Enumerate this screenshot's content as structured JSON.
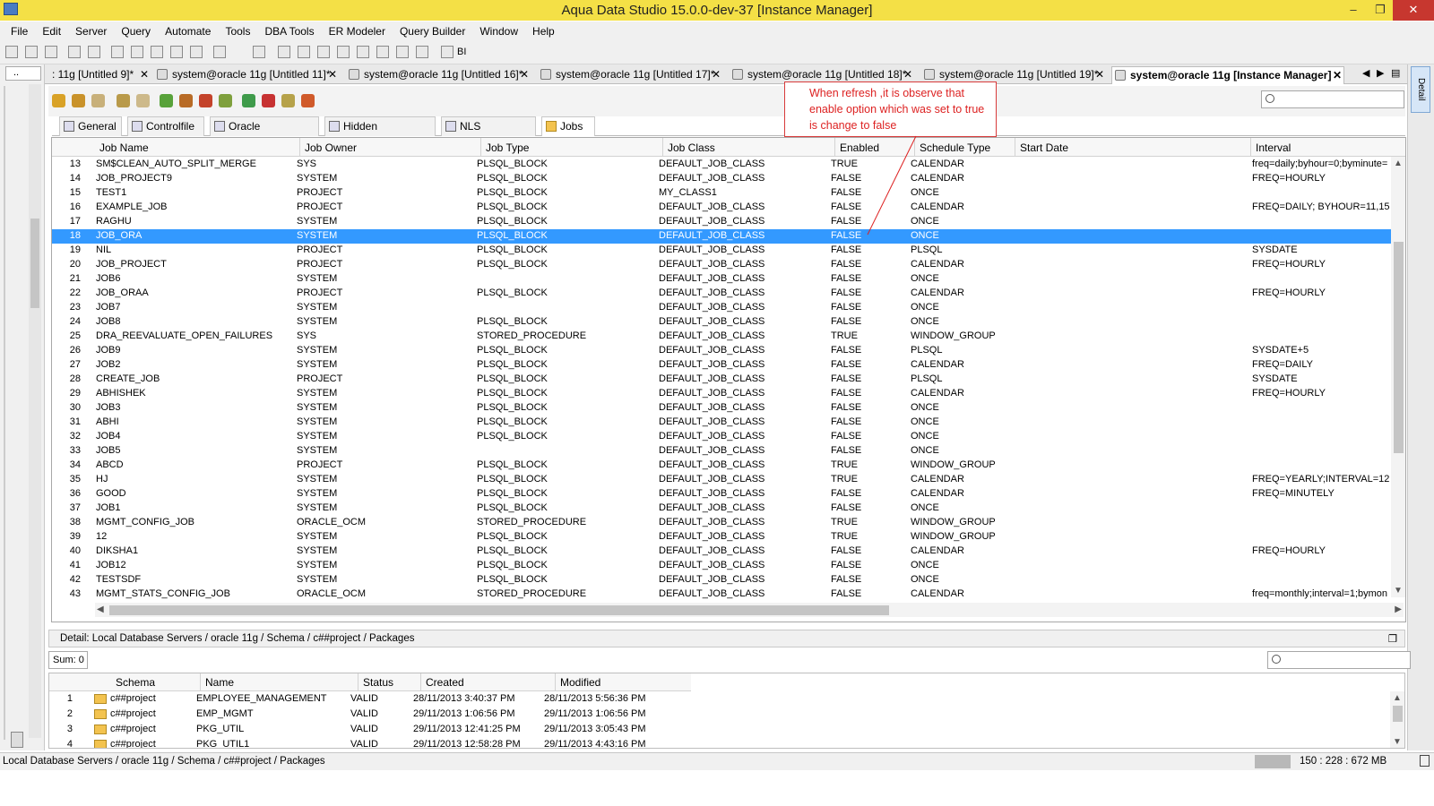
{
  "window": {
    "title": "Aqua Data Studio 15.0.0-dev-37 [Instance Manager]"
  },
  "menu": [
    "File",
    "Edit",
    "Server",
    "Query",
    "Automate",
    "Tools",
    "DBA Tools",
    "ER Modeler",
    "Query Builder",
    "Window",
    "Help"
  ],
  "toolbar": {
    "bi_label": "BI"
  },
  "left_tab_label": "..",
  "tabs": [
    {
      "label": ": 11g [Untitled 9]*",
      "active": false
    },
    {
      "label": "system@oracle 11g [Untitled 11]*",
      "active": false
    },
    {
      "label": "system@oracle 11g [Untitled 16]*",
      "active": false
    },
    {
      "label": "system@oracle 11g [Untitled 17]*",
      "active": false
    },
    {
      "label": "system@oracle 11g [Untitled 18]*",
      "active": false
    },
    {
      "label": "system@oracle 11g [Untitled 19]*",
      "active": false
    },
    {
      "label": "system@oracle 11g [Instance Manager]",
      "active": true
    }
  ],
  "detail_side_tab": "Detail",
  "subtabs": [
    "General",
    "Controlfile",
    "Oracle Parameters",
    "Hidden Parameters",
    "NLS Parameters",
    "Jobs"
  ],
  "active_subtab": "Jobs",
  "callout_text": "When refresh ,it is observe that enable option which was set to true is change to false",
  "jobs": {
    "columns": [
      "Job Name",
      "Job Owner",
      "Job Type",
      "Job Class",
      "Enabled",
      "Schedule Type",
      "Start Date",
      "Interval"
    ],
    "selected_row": 18,
    "rows": [
      [
        "13",
        "SM$CLEAN_AUTO_SPLIT_MERGE",
        "SYS",
        "PLSQL_BLOCK",
        "DEFAULT_JOB_CLASS",
        "TRUE",
        "CALENDAR",
        "",
        "freq=daily;byhour=0;byminute="
      ],
      [
        "14",
        "JOB_PROJECT9",
        "SYSTEM",
        "PLSQL_BLOCK",
        "DEFAULT_JOB_CLASS",
        "FALSE",
        "CALENDAR",
        "",
        "FREQ=HOURLY"
      ],
      [
        "15",
        "TEST1",
        "PROJECT",
        "PLSQL_BLOCK",
        "MY_CLASS1",
        "FALSE",
        "ONCE",
        "",
        ""
      ],
      [
        "16",
        "EXAMPLE_JOB",
        "PROJECT",
        "PLSQL_BLOCK",
        "DEFAULT_JOB_CLASS",
        "FALSE",
        "CALENDAR",
        "",
        "FREQ=DAILY; BYHOUR=11,15"
      ],
      [
        "17",
        "RAGHU",
        "SYSTEM",
        "PLSQL_BLOCK",
        "DEFAULT_JOB_CLASS",
        "FALSE",
        "ONCE",
        "",
        ""
      ],
      [
        "18",
        "JOB_ORA",
        "SYSTEM",
        "PLSQL_BLOCK",
        "DEFAULT_JOB_CLASS",
        "FALSE",
        "ONCE",
        "",
        ""
      ],
      [
        "19",
        "NIL",
        "PROJECT",
        "PLSQL_BLOCK",
        "DEFAULT_JOB_CLASS",
        "FALSE",
        "PLSQL",
        "",
        "SYSDATE"
      ],
      [
        "20",
        "JOB_PROJECT",
        "PROJECT",
        "PLSQL_BLOCK",
        "DEFAULT_JOB_CLASS",
        "FALSE",
        "CALENDAR",
        "",
        "FREQ=HOURLY"
      ],
      [
        "21",
        "JOB6",
        "SYSTEM",
        "",
        "DEFAULT_JOB_CLASS",
        "FALSE",
        "ONCE",
        "",
        ""
      ],
      [
        "22",
        "JOB_ORAA",
        "PROJECT",
        "PLSQL_BLOCK",
        "DEFAULT_JOB_CLASS",
        "FALSE",
        "CALENDAR",
        "",
        "FREQ=HOURLY"
      ],
      [
        "23",
        "JOB7",
        "SYSTEM",
        "",
        "DEFAULT_JOB_CLASS",
        "FALSE",
        "ONCE",
        "",
        ""
      ],
      [
        "24",
        "JOB8",
        "SYSTEM",
        "PLSQL_BLOCK",
        "DEFAULT_JOB_CLASS",
        "FALSE",
        "ONCE",
        "",
        ""
      ],
      [
        "25",
        "DRA_REEVALUATE_OPEN_FAILURES",
        "SYS",
        "STORED_PROCEDURE",
        "DEFAULT_JOB_CLASS",
        "TRUE",
        "WINDOW_GROUP",
        "",
        ""
      ],
      [
        "26",
        "JOB9",
        "SYSTEM",
        "PLSQL_BLOCK",
        "DEFAULT_JOB_CLASS",
        "FALSE",
        "PLSQL",
        "",
        "SYSDATE+5"
      ],
      [
        "27",
        "JOB2",
        "SYSTEM",
        "PLSQL_BLOCK",
        "DEFAULT_JOB_CLASS",
        "FALSE",
        "CALENDAR",
        "",
        "FREQ=DAILY"
      ],
      [
        "28",
        "CREATE_JOB",
        "PROJECT",
        "PLSQL_BLOCK",
        "DEFAULT_JOB_CLASS",
        "FALSE",
        "PLSQL",
        "",
        "SYSDATE"
      ],
      [
        "29",
        "ABHISHEK",
        "SYSTEM",
        "PLSQL_BLOCK",
        "DEFAULT_JOB_CLASS",
        "FALSE",
        "CALENDAR",
        "",
        "FREQ=HOURLY"
      ],
      [
        "30",
        "JOB3",
        "SYSTEM",
        "PLSQL_BLOCK",
        "DEFAULT_JOB_CLASS",
        "FALSE",
        "ONCE",
        "",
        ""
      ],
      [
        "31",
        "ABHI",
        "SYSTEM",
        "PLSQL_BLOCK",
        "DEFAULT_JOB_CLASS",
        "FALSE",
        "ONCE",
        "",
        ""
      ],
      [
        "32",
        "JOB4",
        "SYSTEM",
        "PLSQL_BLOCK",
        "DEFAULT_JOB_CLASS",
        "FALSE",
        "ONCE",
        "",
        ""
      ],
      [
        "33",
        "JOB5",
        "SYSTEM",
        "",
        "DEFAULT_JOB_CLASS",
        "FALSE",
        "ONCE",
        "",
        ""
      ],
      [
        "34",
        "ABCD",
        "PROJECT",
        "PLSQL_BLOCK",
        "DEFAULT_JOB_CLASS",
        "TRUE",
        "WINDOW_GROUP",
        "",
        ""
      ],
      [
        "35",
        "HJ",
        "SYSTEM",
        "PLSQL_BLOCK",
        "DEFAULT_JOB_CLASS",
        "TRUE",
        "CALENDAR",
        "",
        "FREQ=YEARLY;INTERVAL=12"
      ],
      [
        "36",
        "GOOD",
        "SYSTEM",
        "PLSQL_BLOCK",
        "DEFAULT_JOB_CLASS",
        "FALSE",
        "CALENDAR",
        "",
        "FREQ=MINUTELY"
      ],
      [
        "37",
        "JOB1",
        "SYSTEM",
        "PLSQL_BLOCK",
        "DEFAULT_JOB_CLASS",
        "FALSE",
        "ONCE",
        "",
        ""
      ],
      [
        "38",
        "MGMT_CONFIG_JOB",
        "ORACLE_OCM",
        "STORED_PROCEDURE",
        "DEFAULT_JOB_CLASS",
        "TRUE",
        "WINDOW_GROUP",
        "",
        ""
      ],
      [
        "39",
        "12",
        "SYSTEM",
        "PLSQL_BLOCK",
        "DEFAULT_JOB_CLASS",
        "TRUE",
        "WINDOW_GROUP",
        "",
        ""
      ],
      [
        "40",
        "DIKSHA1",
        "SYSTEM",
        "PLSQL_BLOCK",
        "DEFAULT_JOB_CLASS",
        "FALSE",
        "CALENDAR",
        "",
        "FREQ=HOURLY"
      ],
      [
        "41",
        "JOB12",
        "SYSTEM",
        "PLSQL_BLOCK",
        "DEFAULT_JOB_CLASS",
        "FALSE",
        "ONCE",
        "",
        ""
      ],
      [
        "42",
        "TESTSDF",
        "SYSTEM",
        "PLSQL_BLOCK",
        "DEFAULT_JOB_CLASS",
        "FALSE",
        "ONCE",
        "",
        ""
      ],
      [
        "43",
        "MGMT_STATS_CONFIG_JOB",
        "ORACLE_OCM",
        "STORED_PROCEDURE",
        "DEFAULT_JOB_CLASS",
        "FALSE",
        "CALENDAR",
        "",
        "freq=monthly;interval=1;bymon"
      ]
    ]
  },
  "detail": {
    "path_label": "Detail: Local Database Servers / oracle 11g / Schema / c##project / Packages"
  },
  "sum_label": "Sum: 0",
  "packages": {
    "columns": [
      "Schema",
      "Name",
      "Status",
      "Created",
      "Modified"
    ],
    "rows": [
      [
        "1",
        "c##project",
        "EMPLOYEE_MANAGEMENT",
        "VALID",
        "28/11/2013 3:40:37 PM",
        "28/11/2013 5:56:36 PM"
      ],
      [
        "2",
        "c##project",
        "EMP_MGMT",
        "VALID",
        "29/11/2013 1:06:56 PM",
        "29/11/2013 1:06:56 PM"
      ],
      [
        "3",
        "c##project",
        "PKG_UTIL",
        "VALID",
        "29/11/2013 12:41:25 PM",
        "29/11/2013 3:05:43 PM"
      ],
      [
        "4",
        "c##project",
        "PKG_UTIL1",
        "VALID",
        "29/11/2013 12:58:28 PM",
        "29/11/2013 4:43:16 PM"
      ]
    ]
  },
  "status": {
    "path": "Local Database Servers / oracle 11g / Schema / c##project / Packages",
    "memory": "150 : 228 : 672 MB"
  },
  "colors": {
    "titlebar": "#f4e046",
    "selection": "#3399ff",
    "callout": "#d22222"
  }
}
